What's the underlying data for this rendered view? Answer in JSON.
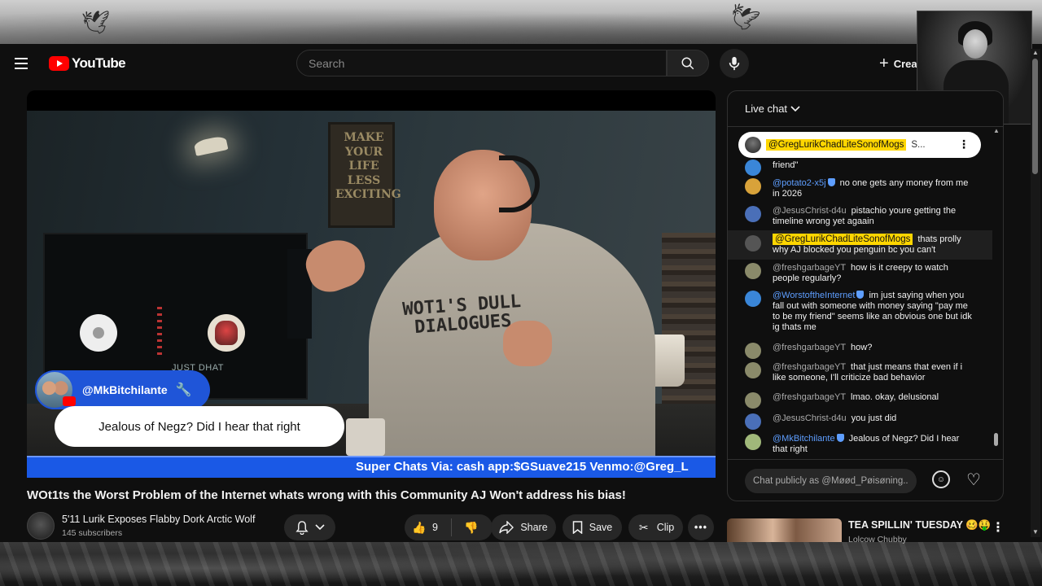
{
  "header": {
    "logo_text": "YouTube",
    "search_placeholder": "Search",
    "create_label": "Crea"
  },
  "video": {
    "poster_text": "MAKE YOUR LIFE LESS EXCITING",
    "shirt_text": "WOT1'S DULL DIALOGUES",
    "monitor_caption": "JUST DHAT",
    "superchat": {
      "author": "@MkBitchilante",
      "message": "Jealous of Negz? Did I hear that right"
    },
    "ticker_text": "Super Chats Via: cash app:$GSuave215 Venmo:@Greg_L"
  },
  "title": "WOt1ts the Worst Problem of the Internet whats wrong with this Community AJ Won't address his bias!",
  "channel": {
    "name": "5'11 Lurik Exposes Flabby Dork Arctic Wolf",
    "subscribers": "145 subscribers"
  },
  "actions": {
    "like_count": "9",
    "share_label": "Share",
    "save_label": "Save",
    "clip_label": "Clip"
  },
  "chat": {
    "header_label": "Live chat",
    "pinned": {
      "author": "@GregLurikChadLiteSonofMogs",
      "text": "S..."
    },
    "messages": [
      {
        "author": "",
        "text": "friend\"",
        "avatar_color": "#3a86d8"
      },
      {
        "author": "@potato2-x5j",
        "text": "no one gets any money from me in 2026",
        "badge": true,
        "author_style": "blue",
        "avatar_color": "#d8a23a"
      },
      {
        "author": "@JesusChrist-d4u",
        "text": "pistachio youre getting the timeline wrong yet agaain",
        "avatar_color": "#4a6fb8"
      },
      {
        "author": "@GregLurikChadLiteSonofMogs",
        "text": "thats prolly why AJ blocked you penguin bc you can't",
        "author_style": "highlight",
        "avatar_color": "#555555"
      },
      {
        "author": "@freshgarbageYT",
        "text": "how is it creepy to watch people regularly?",
        "avatar_color": "#8a8a6a"
      },
      {
        "author": "@WorstoftheInternet",
        "text": "im just saying when you fall out with someone with money saying \"pay me to be my friend\" seems like an obvious one but idk ig thats me",
        "badge": true,
        "author_style": "blue",
        "avatar_color": "#3a86d8"
      },
      {
        "author": "@freshgarbageYT",
        "text": "how?",
        "avatar_color": "#8a8a6a"
      },
      {
        "author": "@freshgarbageYT",
        "text": "that just means that even if i like someone, I'll criticize bad behavior",
        "avatar_color": "#8a8a6a"
      },
      {
        "author": "@freshgarbageYT",
        "text": "lmao. okay, delusional",
        "avatar_color": "#8a8a6a"
      },
      {
        "author": "@JesusChrist-d4u",
        "text": "you just did",
        "avatar_color": "#4a6fb8"
      },
      {
        "author": "@MkBitchilante",
        "text": "Jealous of Negz? Did I hear that right",
        "badge": true,
        "author_style": "blue",
        "avatar_color": "#a0b87a"
      }
    ],
    "input_placeholder": "Chat publicly as @Møød_Pøisøning..."
  },
  "recommended": {
    "title": "TEA SPILLIN' TUESDAY 🥴🤑",
    "channel": "Lolcow Chubby"
  },
  "colors": {
    "accent_red": "#ff0000",
    "ticker_blue": "#1a59e6",
    "highlight_yellow": "#ffd600",
    "author_blue": "#5e9eff"
  }
}
